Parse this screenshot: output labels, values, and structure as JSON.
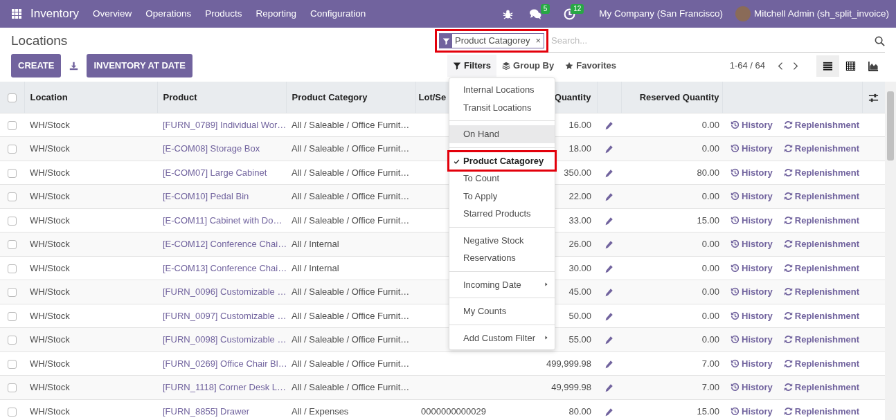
{
  "navbar": {
    "app": "Inventory",
    "menu": [
      "Overview",
      "Operations",
      "Products",
      "Reporting",
      "Configuration"
    ],
    "messages_badge": "5",
    "activities_badge": "12",
    "company": "My Company (San Francisco)",
    "user": "Mitchell Admin (sh_split_invoice)"
  },
  "control_panel": {
    "title": "Locations",
    "buttons": [
      "CREATE",
      "INVENTORY AT DATE"
    ],
    "search": {
      "facets": [
        {
          "label": "Product Catagorey",
          "remove": "×",
          "outlined": true
        }
      ],
      "placeholder": "Search..."
    },
    "filter_menus": [
      {
        "kind": "filter",
        "label": "Filters",
        "open": true
      },
      {
        "kind": "group",
        "label": "Group By",
        "open": false
      },
      {
        "kind": "favorite",
        "label": "Favorites",
        "open": false
      }
    ],
    "pager": "1-64 / 64",
    "views": [
      {
        "kind": "list",
        "selected": true
      },
      {
        "kind": "pivot",
        "selected": false
      },
      {
        "kind": "graph",
        "selected": false
      }
    ]
  },
  "filters_dropdown": {
    "groups": [
      {
        "items": [
          {
            "label": "Internal Locations",
            "checked": false,
            "highlighted": false,
            "outlined": false,
            "submenu": false
          },
          {
            "label": "Transit Locations",
            "checked": false,
            "highlighted": false,
            "outlined": false,
            "submenu": false
          }
        ]
      },
      {
        "items": [
          {
            "label": "On Hand",
            "checked": false,
            "highlighted": true,
            "outlined": false,
            "submenu": false
          }
        ]
      },
      {
        "items": [
          {
            "label": "Product Catagorey",
            "checked": true,
            "highlighted": false,
            "outlined": true,
            "submenu": false
          },
          {
            "label": "To Count",
            "checked": false,
            "highlighted": false,
            "outlined": false,
            "submenu": false
          },
          {
            "label": "To Apply",
            "checked": false,
            "highlighted": false,
            "outlined": false,
            "submenu": false
          },
          {
            "label": "Starred Products",
            "checked": false,
            "highlighted": false,
            "outlined": false,
            "submenu": false
          }
        ]
      },
      {
        "items": [
          {
            "label": "Negative Stock",
            "checked": false,
            "highlighted": false,
            "outlined": false,
            "submenu": false
          },
          {
            "label": "Reservations",
            "checked": false,
            "highlighted": false,
            "outlined": false,
            "submenu": false
          }
        ]
      },
      {
        "items": [
          {
            "label": "Incoming Date",
            "checked": false,
            "highlighted": false,
            "outlined": false,
            "submenu": true
          }
        ]
      },
      {
        "items": [
          {
            "label": "My Counts",
            "checked": false,
            "highlighted": false,
            "outlined": false,
            "submenu": false
          }
        ]
      },
      {
        "items": [
          {
            "label": "Add Custom Filter",
            "checked": false,
            "highlighted": false,
            "outlined": false,
            "submenu": true
          }
        ]
      }
    ]
  },
  "table": {
    "all_selected": false,
    "columns": [
      "Location",
      "Product",
      "Product Category",
      "Lot/Se",
      "Quantity",
      "Reserved Quantity"
    ],
    "rows": [
      {
        "location": "WH/Stock",
        "product": "[FURN_0789] Individual Wor…",
        "category": "All / Saleable / Office Furnit…",
        "lot": "",
        "quantity": "16.00",
        "reserved": "0.00",
        "actions": [
          "History",
          "Replenishment"
        ],
        "selected": false
      },
      {
        "location": "WH/Stock",
        "product": "[E-COM08] Storage Box",
        "category": "All / Saleable / Office Furnit…",
        "lot": "",
        "quantity": "18.00",
        "reserved": "0.00",
        "actions": [
          "History",
          "Replenishment"
        ],
        "selected": false
      },
      {
        "location": "WH/Stock",
        "product": "[E-COM07] Large Cabinet",
        "category": "All / Saleable / Office Furnit…",
        "lot": "",
        "quantity": "350.00",
        "reserved": "80.00",
        "actions": [
          "History",
          "Replenishment"
        ],
        "selected": false
      },
      {
        "location": "WH/Stock",
        "product": "[E-COM10] Pedal Bin",
        "category": "All / Saleable / Office Furnit…",
        "lot": "",
        "quantity": "22.00",
        "reserved": "0.00",
        "actions": [
          "History",
          "Replenishment"
        ],
        "selected": false
      },
      {
        "location": "WH/Stock",
        "product": "[E-COM11] Cabinet with Do…",
        "category": "All / Saleable / Office Furnit…",
        "lot": "",
        "quantity": "33.00",
        "reserved": "15.00",
        "actions": [
          "History",
          "Replenishment"
        ],
        "selected": false
      },
      {
        "location": "WH/Stock",
        "product": "[E-COM12] Conference Chai…",
        "category": "All / Internal",
        "lot": "",
        "quantity": "26.00",
        "reserved": "0.00",
        "actions": [
          "History",
          "Replenishment"
        ],
        "selected": false
      },
      {
        "location": "WH/Stock",
        "product": "[E-COM13] Conference Chai…",
        "category": "All / Internal",
        "lot": "",
        "quantity": "30.00",
        "reserved": "0.00",
        "actions": [
          "History",
          "Replenishment"
        ],
        "selected": false
      },
      {
        "location": "WH/Stock",
        "product": "[FURN_0096] Customizable …",
        "category": "All / Saleable / Office Furnit…",
        "lot": "",
        "quantity": "45.00",
        "reserved": "0.00",
        "actions": [
          "History",
          "Replenishment"
        ],
        "selected": false
      },
      {
        "location": "WH/Stock",
        "product": "[FURN_0097] Customizable …",
        "category": "All / Saleable / Office Furnit…",
        "lot": "",
        "quantity": "50.00",
        "reserved": "0.00",
        "actions": [
          "History",
          "Replenishment"
        ],
        "selected": false
      },
      {
        "location": "WH/Stock",
        "product": "[FURN_0098] Customizable …",
        "category": "All / Saleable / Office Furnit…",
        "lot": "",
        "quantity": "55.00",
        "reserved": "0.00",
        "actions": [
          "History",
          "Replenishment"
        ],
        "selected": false
      },
      {
        "location": "WH/Stock",
        "product": "[FURN_0269] Office Chair Bl…",
        "category": "All / Saleable / Office Furnit…",
        "lot": "",
        "quantity": "499,999.98",
        "reserved": "7.00",
        "actions": [
          "History",
          "Replenishment"
        ],
        "selected": false
      },
      {
        "location": "WH/Stock",
        "product": "[FURN_1118] Corner Desk L…",
        "category": "All / Saleable / Office Furnit…",
        "lot": "",
        "quantity": "49,999.98",
        "reserved": "7.00",
        "actions": [
          "History",
          "Replenishment"
        ],
        "selected": false
      },
      {
        "location": "WH/Stock",
        "product": "[FURN_8855] Drawer",
        "category": "All / Expenses",
        "lot": "0000000000029",
        "quantity": "80.00",
        "reserved": "15.00",
        "actions": [
          "History",
          "Replenishment"
        ],
        "selected": false
      }
    ]
  }
}
